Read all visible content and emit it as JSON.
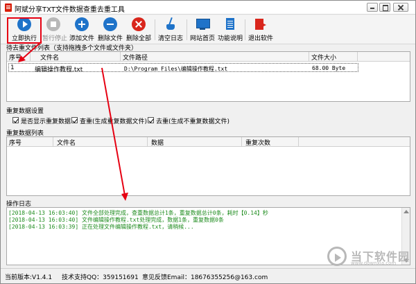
{
  "window": {
    "title": "阿斌分享TXT文件数据查重去重工具"
  },
  "toolbar": {
    "buttons": [
      {
        "label": "立即执行",
        "icon": "play-icon",
        "enabled": true
      },
      {
        "label": "暂行停止",
        "icon": "stop-icon",
        "enabled": false
      },
      {
        "label": "添加文件",
        "icon": "plus-icon",
        "enabled": true
      },
      {
        "label": "删除文件",
        "icon": "minus-icon",
        "enabled": true
      },
      {
        "label": "删除全部",
        "icon": "delete-all-icon",
        "enabled": true
      },
      {
        "label": "清空日志",
        "icon": "broom-icon",
        "enabled": true
      },
      {
        "label": "网站首页",
        "icon": "monitor-icon",
        "enabled": true
      },
      {
        "label": "功能说明",
        "icon": "document-icon",
        "enabled": true
      },
      {
        "label": "退出软件",
        "icon": "exit-icon",
        "enabled": true
      }
    ]
  },
  "file_list": {
    "label": "待去重文件列表（支持拖拽多个文件或文件夹）",
    "columns": [
      "序号",
      "文件名",
      "文件路径",
      "文件大小"
    ],
    "rows": [
      {
        "index": "1",
        "name": "编辑操作教程.txt",
        "path": "D:\\Program Files\\编辑操作教程.txt",
        "size": "68.00 Byte"
      }
    ]
  },
  "settings": {
    "label": "重复数据设置",
    "options": [
      {
        "label": "是否显示重复数据",
        "checked": true
      },
      {
        "label": "查重(生成重复数据文件)",
        "checked": true
      },
      {
        "label": "去重(生成不重复数据文件)",
        "checked": true
      }
    ]
  },
  "duplicates": {
    "label": "重复数据列表",
    "columns": [
      "序号",
      "文件名",
      "数据",
      "重复次数"
    ]
  },
  "log": {
    "label": "操作日志",
    "lines": [
      "[2018-04-13 16:03:40] 文件全部处理完成，查重数据总计1条，重复数据总计0条，耗时【0.14】秒",
      "[2018-04-13 16:03:40] 文件编辑操作教程.txt处理完成，数据1条，重复数据0条",
      "[2018-04-13 16:03:39] 正在处理文件编辑操作教程.txt，请稍候..."
    ],
    "text_color": "#1d8b1d"
  },
  "status": {
    "version": "当前版本:V1.4.1",
    "qq": "技术支持QQ：359151691",
    "email": "意见反馈Email：18676355256@163.com"
  },
  "watermark": {
    "name": "当下软件园",
    "url": "www.downxia.com"
  },
  "colors": {
    "accent": "#1f73c9",
    "danger": "#d9261c",
    "annotation": "#e60012"
  }
}
